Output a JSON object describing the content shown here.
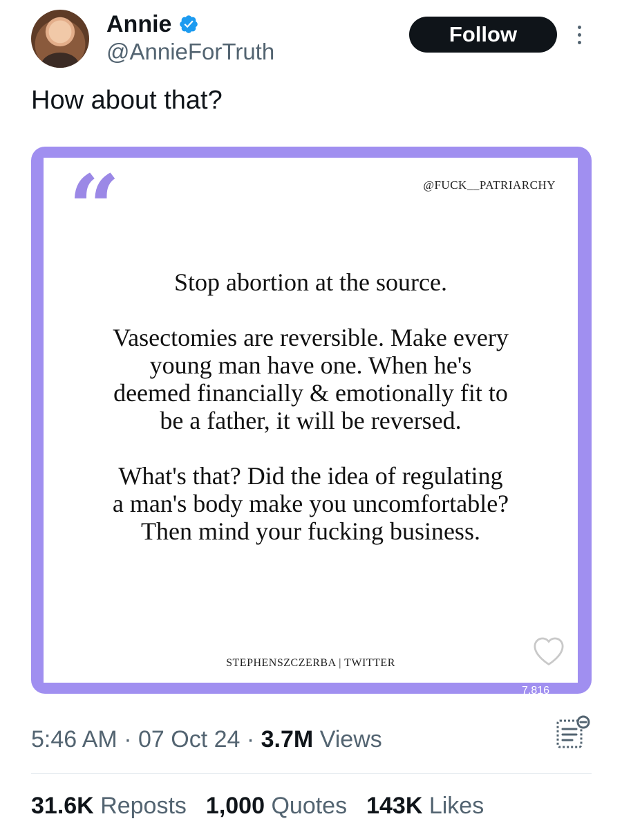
{
  "author": {
    "display_name": "Annie",
    "handle": "@AnnieForTruth",
    "verified": true,
    "verified_icon": "verified-badge-icon"
  },
  "actions": {
    "follow_label": "Follow",
    "more_icon": "more-vertical-icon"
  },
  "tweet": {
    "text": "How about that?"
  },
  "media_card": {
    "source_tag": "@FUCK__PATRIARCHY",
    "quote_lines": [
      "Stop abortion at the source.",
      "Vasectomies are reversible. Make every",
      "young man have one. When he's",
      "deemed financially & emotionally fit to",
      "be a father, it will be reversed.",
      "What's that? Did the idea of regulating",
      "a man's body make you uncomfortable?",
      "Then mind your fucking business."
    ],
    "credit": "STEPHENSZCZERBA | TWITTER",
    "like_count": "7,816",
    "colors": {
      "frame": "#a08ff0",
      "quote_mark": "#9b88e6"
    }
  },
  "meta": {
    "time": "5:46 AM",
    "date": "07 Oct 24",
    "separator": "·",
    "views_count": "3.7M",
    "views_label": "Views",
    "bookmark_icon": "bookmarks-list-icon"
  },
  "stats": {
    "reposts_count": "31.6K",
    "reposts_label": "Reposts",
    "quotes_count": "1,000",
    "quotes_label": "Quotes",
    "likes_count": "143K",
    "likes_label": "Likes"
  }
}
